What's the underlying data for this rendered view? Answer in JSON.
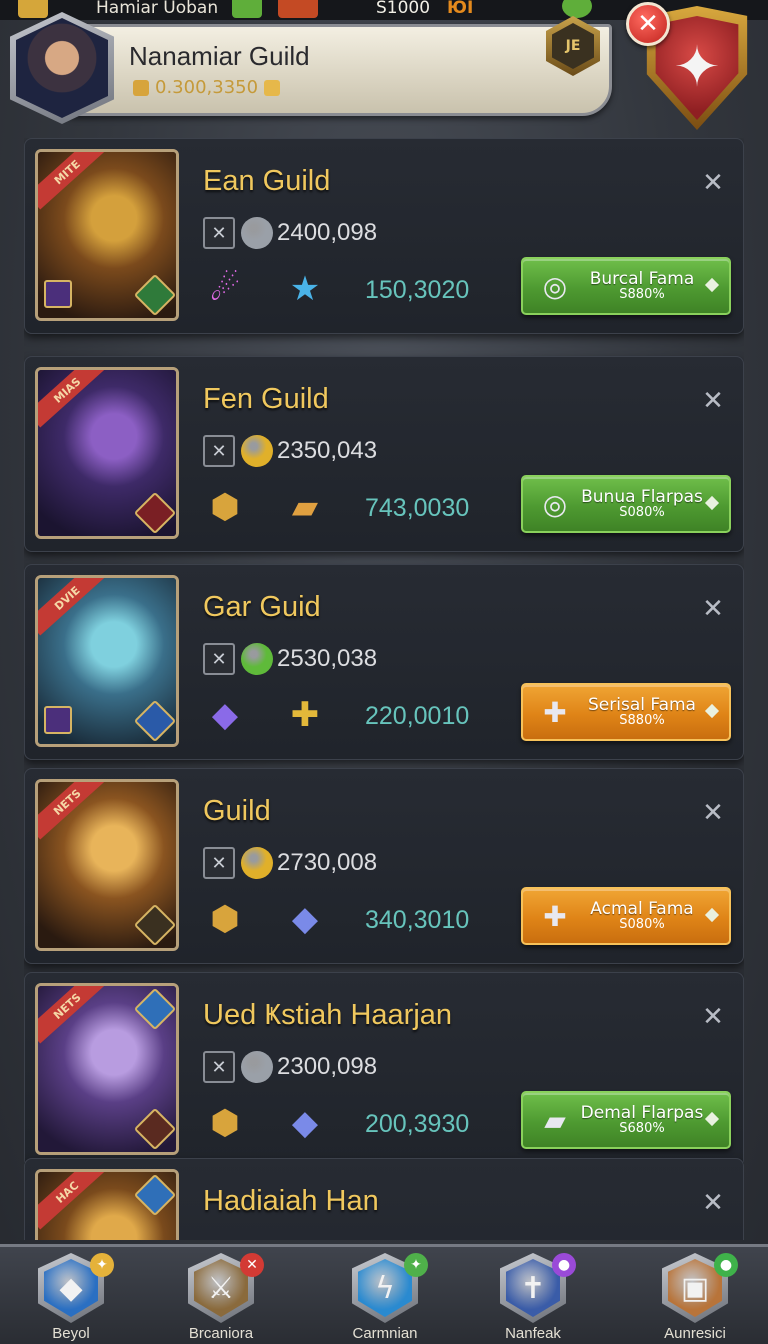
{
  "status_bar": {
    "left_text": "Hamiar Uoban",
    "money": "S1000",
    "indicator": "ЮI"
  },
  "header": {
    "title": "Nanamiar Guild",
    "subtitle": "0.300,3350",
    "rank_badge": "ЈЕ",
    "crest_icon": "star-compass-icon",
    "close_icon": "✕"
  },
  "guilds": [
    {
      "name": "Ean Guild",
      "ribbon": "MITE",
      "stat_value": "2400,098",
      "item_value": "150,3020",
      "button_label": "Burcal Fama",
      "button_price": "S880%",
      "button_color": "green",
      "art_colors": [
        "#d4a03c",
        "#7b4a1c",
        "#2b1a10"
      ],
      "coin_color": "#9aa0a8"
    },
    {
      "name": "Fen Guild",
      "ribbon": "MIAS",
      "stat_value": "2350,043",
      "item_value": "743,0030",
      "button_label": "Bunua Flarpas",
      "button_price": "S080%",
      "button_color": "green",
      "art_colors": [
        "#8c5fc4",
        "#3e2a68",
        "#1b1430"
      ],
      "coin_color": "#e0b02a"
    },
    {
      "name": "Gar Guid",
      "ribbon": "DVIE",
      "stat_value": "2530,038",
      "item_value": "220,0010",
      "button_label": "Serisal Fama",
      "button_price": "S880%",
      "button_color": "orange",
      "art_colors": [
        "#7fd0de",
        "#3a6f8a",
        "#1a2c3a"
      ],
      "coin_color": "#5fba3a"
    },
    {
      "name": "Guild",
      "ribbon": "NETS",
      "stat_value": "2730,008",
      "item_value": "340,3010",
      "button_label": "Acmal Fama",
      "button_price": "S080%",
      "button_color": "orange",
      "art_colors": [
        "#e8b45a",
        "#8a5420",
        "#2a1a10"
      ],
      "coin_color": "#e0b02a"
    },
    {
      "name": "Ued Ҝstiah Haarjan",
      "ribbon": "NETS",
      "stat_value": "2300,098",
      "item_value": "200,3930",
      "button_label": "Demal Flarpas",
      "button_price": "S680%",
      "button_color": "green",
      "art_colors": [
        "#b89ce0",
        "#5a3f86",
        "#221838"
      ],
      "coin_color": "#9aa0a8"
    },
    {
      "name": "Hadiaiah Han",
      "ribbon": "HAC",
      "stat_value": "",
      "item_value": "",
      "button_label": "",
      "button_price": "",
      "button_color": "green",
      "art_colors": [
        "#e0a94a",
        "#7a4a1c",
        "#2a1a10"
      ],
      "coin_color": "#e0b02a"
    }
  ],
  "bottom_nav": [
    {
      "label": "Beyol",
      "icon": "blue-gem-icon",
      "badge": "✦",
      "badge_color": "#e5b23a",
      "icon_bg": "#2a6fc2"
    },
    {
      "label": "Brcaniora",
      "icon": "crossed-swords-icon",
      "badge": "✕",
      "badge_color": "#d33a34",
      "icon_bg": "#8a6a3c"
    },
    {
      "label": "Carmnian",
      "icon": "lightning-shield-icon",
      "badge": "✦",
      "badge_color": "#4fb04a",
      "icon_bg": "#2a8ad0"
    },
    {
      "label": "Nanfeak",
      "icon": "shield-sword-icon",
      "badge": "●",
      "badge_color": "#9a4ad8",
      "icon_bg": "#3a5ca8"
    },
    {
      "label": "Aunresici",
      "icon": "gift-box-icon",
      "badge": "●",
      "badge_color": "#3fb24a",
      "icon_bg": "#b8743a"
    }
  ]
}
